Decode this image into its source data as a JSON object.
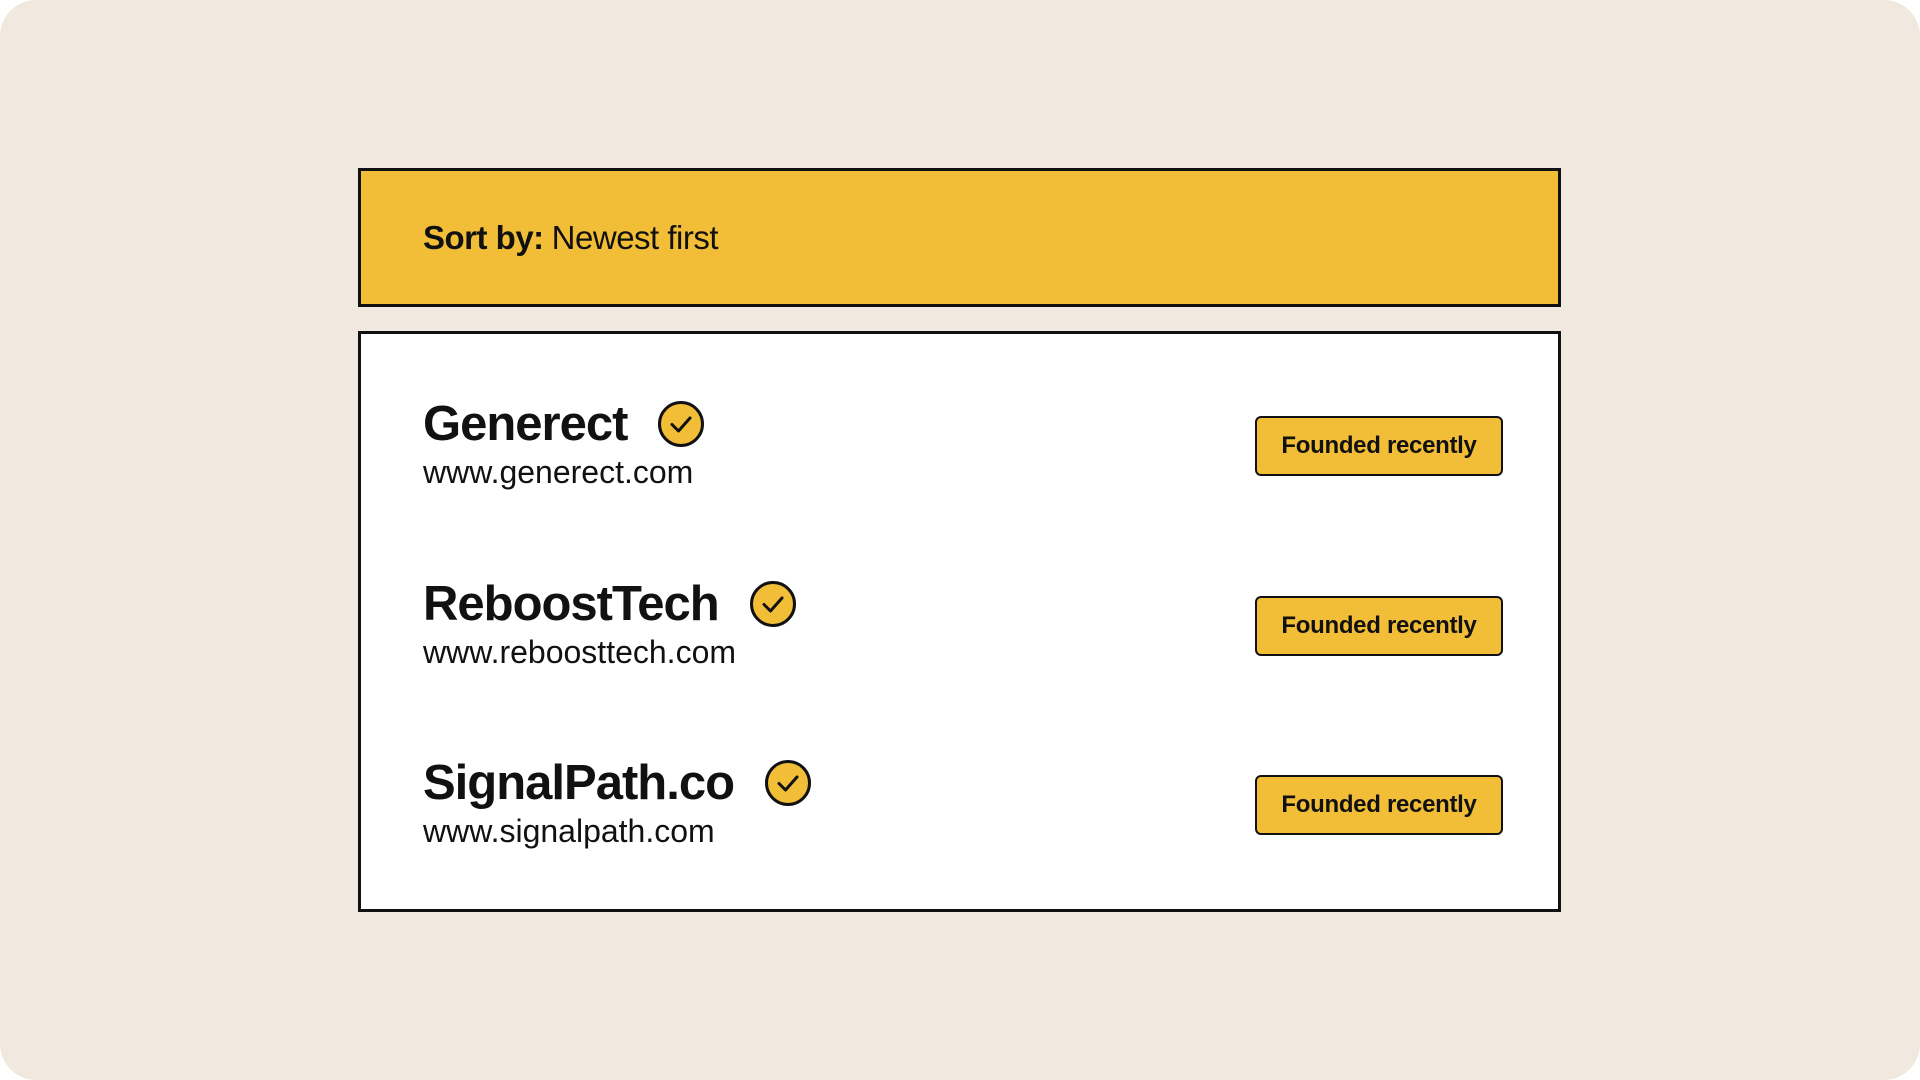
{
  "sort": {
    "label": "Sort by:",
    "value": "Newest first"
  },
  "companies": [
    {
      "name": "Generect",
      "url": "www.generect.com",
      "verified": true,
      "verified_icon": "check-circle-icon",
      "badge": "Founded recently"
    },
    {
      "name": "ReboostTech",
      "url": "www.reboosttech.com",
      "verified": true,
      "verified_icon": "check-circle-icon",
      "badge": "Founded recently"
    },
    {
      "name": "SignalPath.co",
      "url": "www.signalpath.com",
      "verified": true,
      "verified_icon": "check-circle-icon",
      "badge": "Founded recently"
    }
  ],
  "colors": {
    "background": "#f1e9df",
    "accent": "#f2be37",
    "ink": "#111111",
    "card": "#ffffff"
  }
}
